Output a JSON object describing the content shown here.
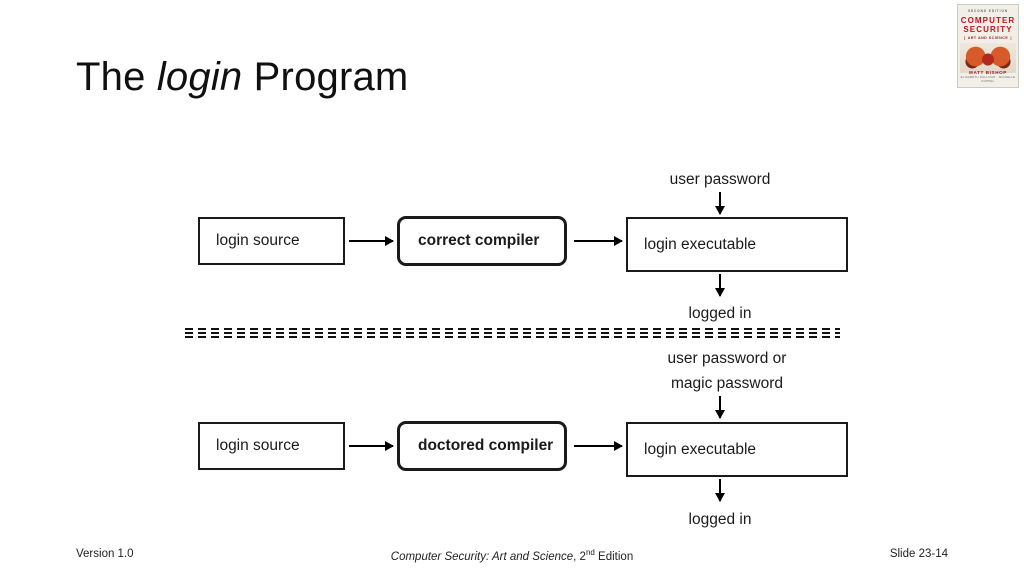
{
  "slide": {
    "title_prefix": "The ",
    "title_emphasis": "login",
    "title_suffix": " Program"
  },
  "book_cover": {
    "edition": "SECOND EDITION",
    "title_line1": "COMPUTER",
    "title_line2": "SECURITY",
    "subtitle": "ART AND SCIENCE",
    "bracket_left": "[",
    "bracket_right": "]",
    "byline": "MATT BISHOP",
    "authors": "ELISABETH SULLIVAN · MICHELLE RUPPEL"
  },
  "diagram": {
    "top_flow": {
      "source_box": "login source",
      "compiler_box": "correct compiler",
      "executable_box": "login executable",
      "input_label": "user password",
      "output_label": "logged in"
    },
    "bottom_flow": {
      "source_box": "login source",
      "compiler_box": "doctored compiler",
      "executable_box": "login executable",
      "input_label_line1": "user password or",
      "input_label_line2": "magic password",
      "output_label": "logged in"
    }
  },
  "footer": {
    "version": "Version 1.0",
    "book_title": "Computer Security: Art and Science",
    "edition_prefix": ", 2",
    "edition_sup": "nd",
    "edition_suffix": " Edition",
    "slide_number": "Slide 23-14"
  },
  "colors": {
    "ink": "#1a1a1a",
    "background": "#ffffff",
    "cover_red": "#c0141b"
  }
}
